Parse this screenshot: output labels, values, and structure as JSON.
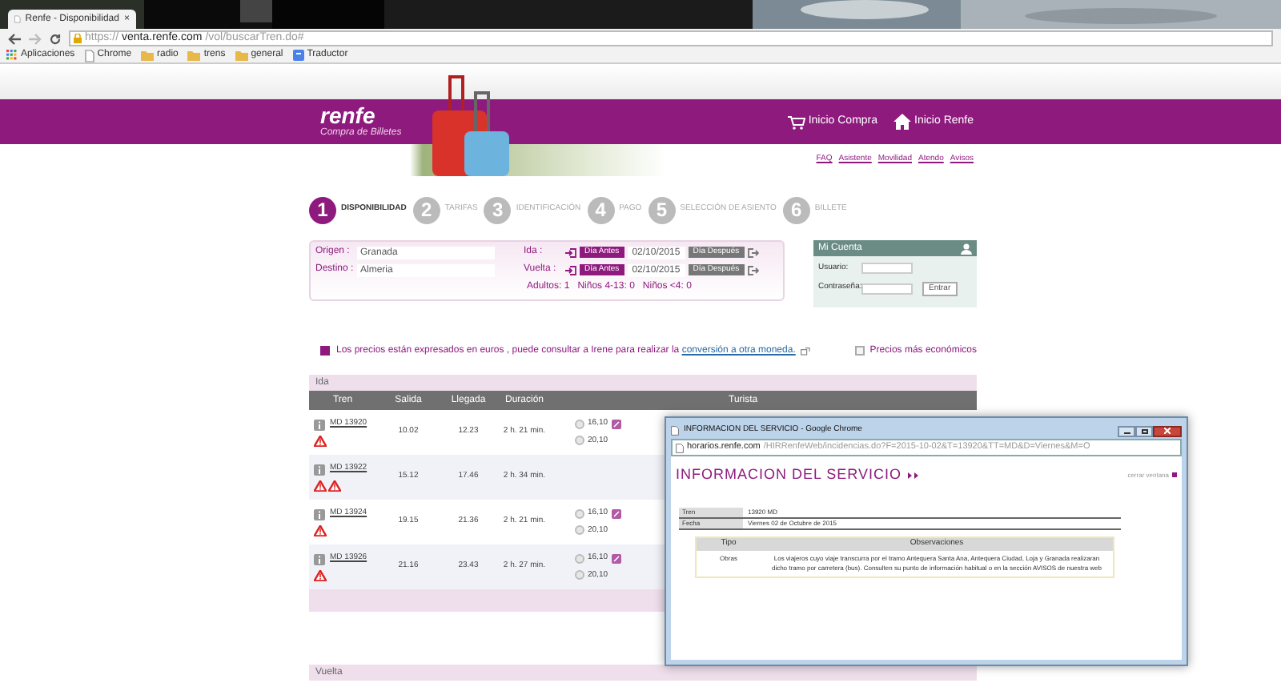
{
  "browser": {
    "tab_title": "Renfe - Disponibilidad",
    "tab_close": "×",
    "url_scheme": "https://",
    "url_host": "venta.renfe.com",
    "url_path": "/vol/buscarTren.do#",
    "bookmarks": [
      {
        "label": "Aplicaciones",
        "kind": "apps"
      },
      {
        "label": "Chrome",
        "kind": "page"
      },
      {
        "label": "radio",
        "kind": "folder"
      },
      {
        "label": "trens",
        "kind": "folder"
      },
      {
        "label": "general",
        "kind": "folder"
      },
      {
        "label": "Traductor",
        "kind": "translate"
      }
    ]
  },
  "header": {
    "logo": "renfe",
    "subtitle": "Compra de Billetes",
    "links": [
      {
        "label": "Inicio Compra",
        "kind": "cart"
      },
      {
        "label": "Inicio Renfe",
        "kind": "home"
      }
    ],
    "nav": [
      "FAQ",
      "Asistente",
      "Movilidad",
      "Atendo",
      "Avisos"
    ]
  },
  "steps": [
    {
      "number": "1",
      "label": "DISPONIBILIDAD",
      "selected": true
    },
    {
      "number": "2",
      "label": "TARIFAS",
      "selected": false
    },
    {
      "number": "3",
      "label": "IDENTIFICACIÓN",
      "selected": false
    },
    {
      "number": "4",
      "label": "PAGO",
      "selected": false
    },
    {
      "number": "5",
      "label": "SELECCIÓN DE ASIENTO",
      "selected": false
    },
    {
      "number": "6",
      "label": "BILLETE",
      "selected": false
    }
  ],
  "search": {
    "places": [
      {
        "label": "Origen :",
        "value": "Granada"
      },
      {
        "label": "Destino :",
        "value": "Almeria"
      }
    ],
    "trips": [
      {
        "label": "Ida :",
        "before": "Día Antes",
        "date": "02/10/2015",
        "after": "Día Después"
      },
      {
        "label": "Vuelta :",
        "before": "Día Antes",
        "date": "02/10/2015",
        "after": "Día Después"
      }
    ],
    "passengers": [
      {
        "label": "Adultos:",
        "value": "1"
      },
      {
        "label": "Niños 4-13:",
        "value": "0"
      },
      {
        "label": "Niños <4:",
        "value": "0"
      }
    ]
  },
  "account": {
    "title": "Mi Cuenta",
    "user_label": "Usuario:",
    "password_label": "Contraseña:",
    "button": "Entrar"
  },
  "notice": {
    "text": "Los precios están expresados en euros , puede consultar a Irene para realizar la",
    "link": "conversión a otra moneda."
  },
  "cheapest": {
    "label": "Precios más económicos",
    "checked": false
  },
  "outbound": {
    "title": "Ida",
    "columns": [
      "Tren",
      "Salida",
      "Llegada",
      "Duración",
      "Turista"
    ],
    "rows": [
      {
        "train": "MD 13920",
        "departure": "10.02",
        "arrival": "12.23",
        "duration": "2 h. 21 min.",
        "alerts": [
          {
            "kind": "warning"
          }
        ],
        "fares": [
          {
            "price": "16,10",
            "selected": false,
            "promo": true
          },
          {
            "price": "20,10",
            "selected": false,
            "promo": false
          }
        ]
      },
      {
        "train": "MD 13922",
        "departure": "15.12",
        "arrival": "17.46",
        "duration": "2 h. 34 min.",
        "alerts": [
          {
            "kind": "warning"
          },
          {
            "kind": "warning"
          }
        ],
        "fares": []
      },
      {
        "train": "MD 13924",
        "departure": "19.15",
        "arrival": "21.36",
        "duration": "2 h. 21 min.",
        "alerts": [
          {
            "kind": "warning"
          }
        ],
        "fares": [
          {
            "price": "16,10",
            "selected": false,
            "promo": true
          },
          {
            "price": "20,10",
            "selected": false,
            "promo": false
          }
        ]
      },
      {
        "train": "MD 13926",
        "departure": "21.16",
        "arrival": "23.43",
        "duration": "2 h. 27 min.",
        "alerts": [
          {
            "kind": "warning"
          }
        ],
        "fares": [
          {
            "price": "16,10",
            "selected": false,
            "promo": true
          },
          {
            "price": "20,10",
            "selected": false,
            "promo": false
          }
        ]
      }
    ]
  },
  "return": {
    "title": "Vuelta"
  },
  "popup": {
    "title": "INFORMACION DEL SERVICIO - Google Chrome",
    "url_host": "horarios.renfe.com",
    "url_path": "/HIRRenfeWeb/incidencias.do?F=2015-10-02&T=13920&TT=MD&D=Viernes&M=O",
    "heading": "INFORMACION DEL SERVICIO",
    "close_link": "cerrar ventana",
    "details": [
      {
        "label": "Tren",
        "value": "13920 MD"
      },
      {
        "label": "Fecha",
        "value": "Viernes 02 de Octubre de 2015"
      }
    ],
    "columns": [
      "Tipo",
      "Observaciones"
    ],
    "rows": [
      {
        "type": "Obras",
        "observation": "Los viajeros cuyo viaje transcurra por el tramo Antequera Santa Ana, Antequera Ciudad, Loja y Granada realizaran dicho tramo por carretera (bus). Consulten su punto de información habitual o en la sección AVISOS de nuestra web"
      }
    ]
  }
}
